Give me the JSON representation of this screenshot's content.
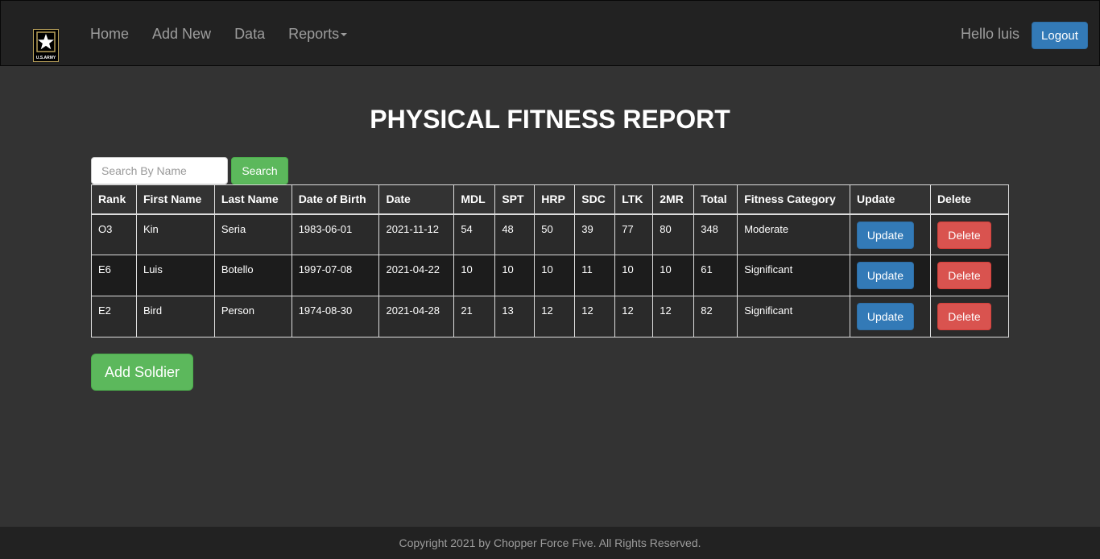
{
  "brand": {
    "logo_icon": "us-army-star-icon",
    "logo_text": "U.S.ARMY",
    "accent_color": "#b8a05a"
  },
  "nav": {
    "items": [
      {
        "label": "Home"
      },
      {
        "label": "Add New"
      },
      {
        "label": "Data"
      },
      {
        "label": "Reports"
      }
    ],
    "greeting": "Hello luis",
    "logout_label": "Logout"
  },
  "page": {
    "title": "PHYSICAL FITNESS REPORT"
  },
  "search": {
    "placeholder": "Search By Name",
    "value": "",
    "button_label": "Search"
  },
  "table": {
    "headers": [
      "Rank",
      "First Name",
      "Last Name",
      "Date of Birth",
      "Date",
      "MDL",
      "SPT",
      "HRP",
      "SDC",
      "LTK",
      "2MR",
      "Total",
      "Fitness Category",
      "Update",
      "Delete"
    ],
    "rows": [
      {
        "rank": "O3",
        "first_name": "Kin",
        "last_name": "Seria",
        "dob": "1983-06-01",
        "date": "2021-11-12",
        "mdl": "54",
        "spt": "48",
        "hrp": "50",
        "sdc": "39",
        "ltk": "77",
        "mr2": "80",
        "total": "348",
        "category": "Moderate",
        "update_label": "Update",
        "delete_label": "Delete"
      },
      {
        "rank": "E6",
        "first_name": "Luis",
        "last_name": "Botello",
        "dob": "1997-07-08",
        "date": "2021-04-22",
        "mdl": "10",
        "spt": "10",
        "hrp": "10",
        "sdc": "11",
        "ltk": "10",
        "mr2": "10",
        "total": "61",
        "category": "Significant",
        "update_label": "Update",
        "delete_label": "Delete"
      },
      {
        "rank": "E2",
        "first_name": "Bird",
        "last_name": "Person",
        "dob": "1974-08-30",
        "date": "2021-04-28",
        "mdl": "21",
        "spt": "13",
        "hrp": "12",
        "sdc": "12",
        "ltk": "12",
        "mr2": "12",
        "total": "82",
        "category": "Significant",
        "update_label": "Update",
        "delete_label": "Delete"
      }
    ]
  },
  "add_soldier_label": "Add Soldier",
  "footer": {
    "text": "Copyright 2021 by Chopper Force Five. All Rights Reserved."
  },
  "colors": {
    "primary": "#337ab7",
    "success": "#5cb85c",
    "danger": "#d9534f",
    "background": "#333333",
    "navbar": "#222222"
  }
}
